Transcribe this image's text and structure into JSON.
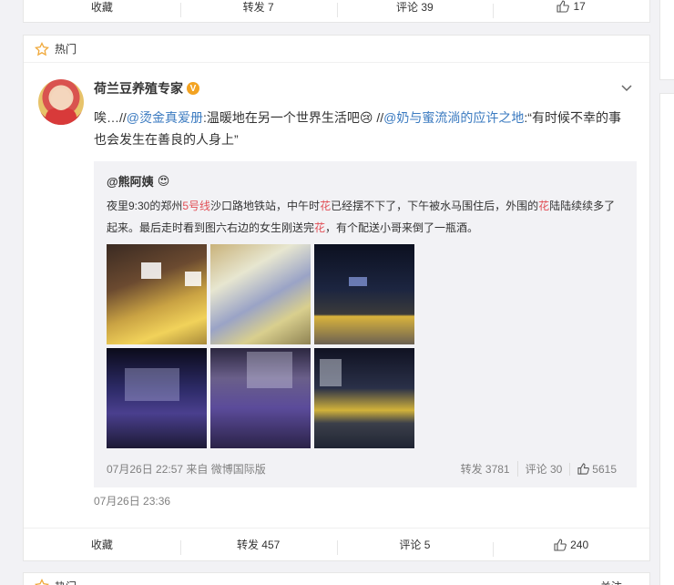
{
  "top_actions": {
    "collect": "收藏",
    "forward": "转发 7",
    "comment": "评论 39",
    "like": "17"
  },
  "hot": {
    "label": "热门"
  },
  "post": {
    "author": "荷兰豆养殖专家",
    "text_prefix": "唉…//",
    "mention1": "@烫金真爱册",
    "text_mid": ":温暖地在另一个世界生活吧",
    "emoji": "😢",
    "text_sep": " //",
    "mention2": "@奶与蜜流淌的应许之地",
    "text_quote": ":“有时候不幸的事也会发生在善良的人身上”",
    "time": "07月26日 23:36"
  },
  "repost": {
    "name": "@熊阿姨",
    "emoji": "😍",
    "t1": "夜里9:30的郑州",
    "t1_hl": "5号线",
    "t2": "沙口路地铁站，中午时",
    "t2_hl": "花",
    "t3": "已经摆不下了，下午被水马围住后，外围的",
    "t3_hl": "花",
    "t4": "陆陆续续多了起来。最后走时看到图六右边的女生刚送完",
    "t4_hl": "花",
    "t5": "，有个配送小哥来倒了一瓶酒。",
    "meta_time": "07月26日 22:57 来自 微博国际版",
    "forward": "转发 3781",
    "comment": "评论 30",
    "like": "5615"
  },
  "bottom_actions": {
    "collect": "收藏",
    "forward": "转发 457",
    "comment": "评论 5",
    "like": "240"
  },
  "next_card": {
    "label": "热门",
    "right": "关注"
  }
}
